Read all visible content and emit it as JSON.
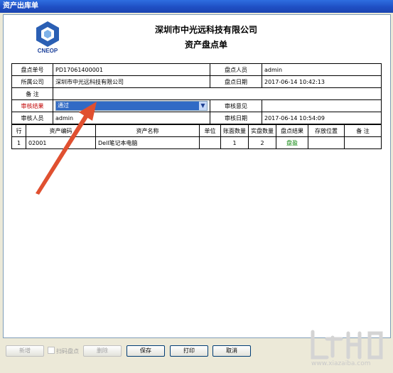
{
  "window": {
    "title": "资产出库单"
  },
  "header": {
    "logo_text": "CNEOP",
    "company": "深圳市中光远科技有限公司",
    "doc_title": "资产盘点单"
  },
  "form": {
    "doc_no_label": "盘点单号",
    "doc_no": "PD17061400001",
    "person_label": "盘点人员",
    "person": "admin",
    "company_label": "所属公司",
    "company": "深圳市中光远科技有限公司",
    "date_label": "盘点日期",
    "date": "2017-06-14 10:42:13",
    "remark_label": "备  注",
    "remark": "",
    "audit_result_label": "审核结果",
    "audit_result": "通过",
    "audit_opinion_label": "审核意见",
    "audit_opinion": "",
    "auditor_label": "审核人员",
    "auditor": "admin",
    "audit_date_label": "审核日期",
    "audit_date": "2017-06-14 10:54:09"
  },
  "table": {
    "columns": [
      "行",
      "资产编码",
      "资产名称",
      "单位",
      "账面数量",
      "实盘数量",
      "盘点结果",
      "存放位置",
      "备  注"
    ],
    "rows": [
      {
        "row": "1",
        "code": "02001",
        "name": "Dell笔记本电脑",
        "unit": "",
        "book_qty": "1",
        "actual_qty": "2",
        "result": "盘盈",
        "location": "",
        "remark": ""
      }
    ]
  },
  "buttons": {
    "add": "新增",
    "scan_checkbox": "扫码盘点",
    "delete": "删除",
    "save": "保存",
    "print": "打印",
    "cancel": "取消"
  },
  "watermark": {
    "text": "www.xiazaiba.com"
  },
  "colors": {
    "titlebar": "#1f4fc4",
    "selection": "#316ac5",
    "label_red": "#c00000",
    "result_green": "#008000",
    "arrow": "#e05030"
  }
}
